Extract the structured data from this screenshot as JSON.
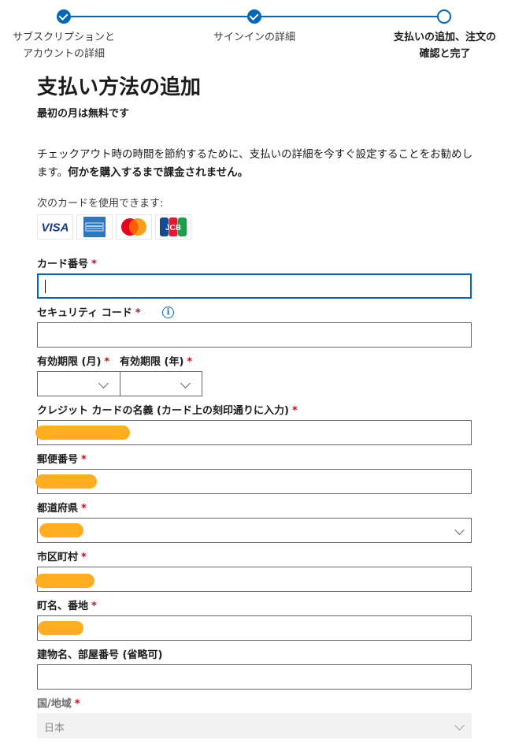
{
  "stepper": {
    "steps": [
      {
        "label_line1": "サブスクリプションと",
        "label_line2": "アカウントの詳細",
        "state": "done"
      },
      {
        "label_line1": "サインインの詳細",
        "label_line2": "",
        "state": "done"
      },
      {
        "label_line1": "支払いの追加、注文の",
        "label_line2": "確認と完了",
        "state": "current"
      }
    ]
  },
  "page": {
    "title": "支払い方法の追加",
    "subtitle": "最初の月は無料です",
    "desc_text": "チェックアウト時の時間を節約するために、支払いの詳細を今すぐ設定することをお勧めします。",
    "desc_bold": "何かを購入するまで課金されません。",
    "cards_label": "次のカードを使用できます:",
    "cards": [
      "VISA",
      "AMERICAN EXPRESS",
      "Mastercard",
      "JCB"
    ]
  },
  "form": {
    "required_mark": "*",
    "card_number_label": "カード番号",
    "card_number_value": "",
    "security_code_label": "セキュリティ コード",
    "security_code_value": "",
    "info_glyph": "i",
    "exp_month_label": "有効期限 (月)",
    "exp_year_label": "有効期限 (年)",
    "exp_month_value": "",
    "exp_year_value": "",
    "name_label": "クレジット カードの名義 (カード上の刻印通りに入力)",
    "postal_label": "郵便番号",
    "prefecture_label": "都道府県",
    "city_label": "市区町村",
    "address_label": "町名、番地",
    "building_label": "建物名、部屋番号 (省略可)",
    "building_value": "",
    "country_label": "国/地域",
    "country_value": "日本"
  },
  "colors": {
    "accent": "#0067b8",
    "required": "#c50f1f",
    "redaction": "#ffae21"
  }
}
